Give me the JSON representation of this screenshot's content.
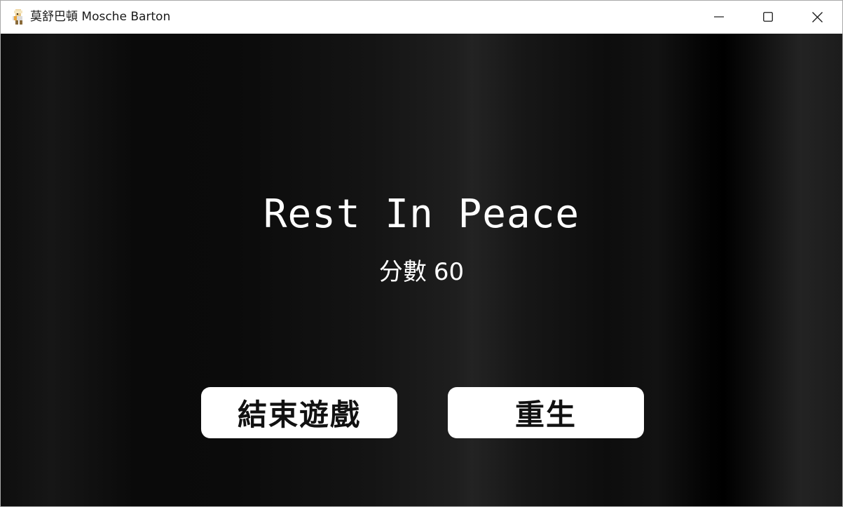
{
  "window": {
    "title": "莫舒巴頓 Mosche Barton",
    "app_icon": "pixel-character-icon",
    "controls": {
      "minimize_icon": "minimize-icon",
      "maximize_icon": "maximize-icon",
      "close_icon": "close-icon"
    }
  },
  "game": {
    "headline": "Rest In Peace",
    "score_label": "分數",
    "score_value": "60",
    "buttons": {
      "quit_label": "結束遊戲",
      "respawn_label": "重生"
    }
  }
}
